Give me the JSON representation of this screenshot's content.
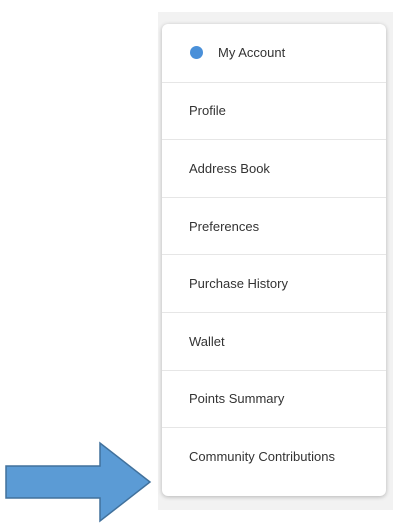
{
  "menu": {
    "header": {
      "label": "My Account",
      "dot_color": "#4a90d9"
    },
    "items": [
      {
        "label": "Profile"
      },
      {
        "label": "Address Book"
      },
      {
        "label": "Preferences"
      },
      {
        "label": "Purchase History"
      },
      {
        "label": "Wallet"
      },
      {
        "label": "Points Summary"
      },
      {
        "label": "Community Contributions"
      }
    ]
  },
  "annotation": {
    "icon": "right-arrow-icon",
    "fill_color": "#5b9bd5",
    "stroke_color": "#41719c"
  }
}
